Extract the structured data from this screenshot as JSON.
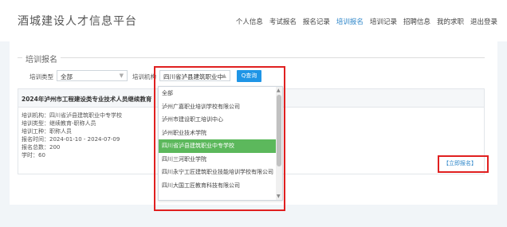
{
  "header": {
    "title": "酒城建设人才信息平台",
    "nav": [
      {
        "label": "个人信息",
        "active": false
      },
      {
        "label": "考试报名",
        "active": false
      },
      {
        "label": "报名记录",
        "active": false
      },
      {
        "label": "培训报名",
        "active": true
      },
      {
        "label": "培训记录",
        "active": false
      },
      {
        "label": "招聘信息",
        "active": false
      },
      {
        "label": "我的求职",
        "active": false
      },
      {
        "label": "退出登录",
        "active": false
      }
    ]
  },
  "section": {
    "title": "培训报名"
  },
  "filters": {
    "training_type_label": "培训类型",
    "training_type_value": "全部",
    "training_org_label": "培训机构",
    "training_org_value": "四川省泸县建筑职业中",
    "query_button": "Q查询"
  },
  "card": {
    "title": "2024年泸州市工程建设类专业技术人员继续教育",
    "org": "培训机构：四川省泸县建筑职业中专学校",
    "type": "培训类型：继续教育-职称人员",
    "job": "培训工种：职称人员",
    "time": "报名时间：2024-01-10 - 2024-07-09",
    "count": "报名总数：200",
    "hours": "学时：60",
    "apply_label": "【立即报名】"
  },
  "dropdown": {
    "options": [
      "全部",
      "泸州广嘉职业培训学校有限公司",
      "泸州市建设职工培训中心",
      "泸州职业技术学院",
      "四川省泸县建筑职业中专学校",
      "四川三河职业学院",
      "四川永宁工匠建筑职业技能培训学校有限公司",
      "四川大国工匠教育科技有限公司"
    ],
    "selected_index": 4
  },
  "colors": {
    "accent": "#2e86c9",
    "query_button": "#1f95e6",
    "selected_option": "#5cb85c",
    "highlight_box": "#e02020"
  }
}
